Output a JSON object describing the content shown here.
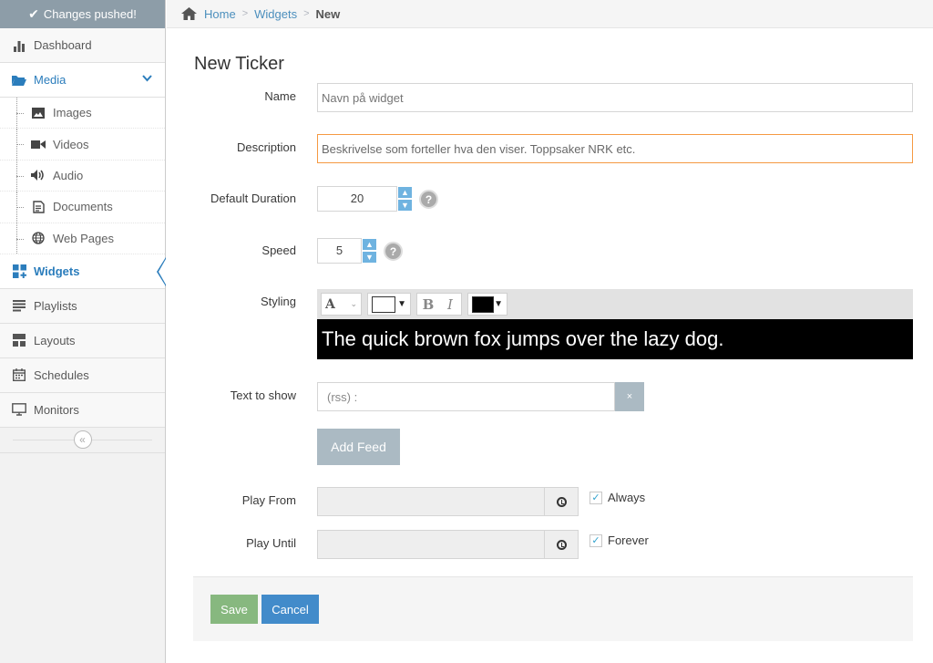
{
  "sidebar": {
    "notice": "Changes pushed!",
    "items": [
      {
        "label": "Dashboard",
        "icon": "bar-chart-icon"
      },
      {
        "label": "Media",
        "icon": "folder-open-icon"
      },
      {
        "label": "Widgets",
        "icon": "widgets-icon"
      },
      {
        "label": "Playlists",
        "icon": "list-icon"
      },
      {
        "label": "Layouts",
        "icon": "layout-icon"
      },
      {
        "label": "Schedules",
        "icon": "calendar-icon"
      },
      {
        "label": "Monitors",
        "icon": "monitor-icon"
      }
    ],
    "media_sub": [
      {
        "label": "Images",
        "icon": "image-icon"
      },
      {
        "label": "Videos",
        "icon": "video-icon"
      },
      {
        "label": "Audio",
        "icon": "volume-icon"
      },
      {
        "label": "Documents",
        "icon": "document-icon"
      },
      {
        "label": "Web Pages",
        "icon": "globe-icon"
      }
    ],
    "collapse_glyph": "«"
  },
  "breadcrumb": {
    "home": "Home",
    "widgets": "Widgets",
    "current": "New"
  },
  "form": {
    "title": "New Ticker",
    "name_label": "Name",
    "name_placeholder": "Navn på widget",
    "description_label": "Description",
    "description_value": "Beskrivelse som forteller hva den viser. Toppsaker NRK etc.",
    "duration_label": "Default Duration",
    "duration_value": "20",
    "speed_label": "Speed",
    "speed_value": "5",
    "styling_label": "Styling",
    "font_glyph": "A",
    "bold_glyph": "B",
    "italic_glyph": "I",
    "bg_color": "#ffffff",
    "text_color": "#000000",
    "preview_text": "The quick brown fox jumps over the lazy dog.",
    "text_to_show_label": "Text to show",
    "feed_value": "(rss) :",
    "feed_remove": "×",
    "add_feed": "Add Feed",
    "play_from_label": "Play From",
    "always_label": "Always",
    "play_until_label": "Play Until",
    "forever_label": "Forever",
    "save": "Save",
    "cancel": "Cancel",
    "help_glyph": "?"
  },
  "colors": {
    "accent": "#2b7dbc",
    "save": "#87b87f",
    "cancel": "#428bca",
    "spin": "#6fb3e0",
    "focus_border": "#f59942"
  }
}
